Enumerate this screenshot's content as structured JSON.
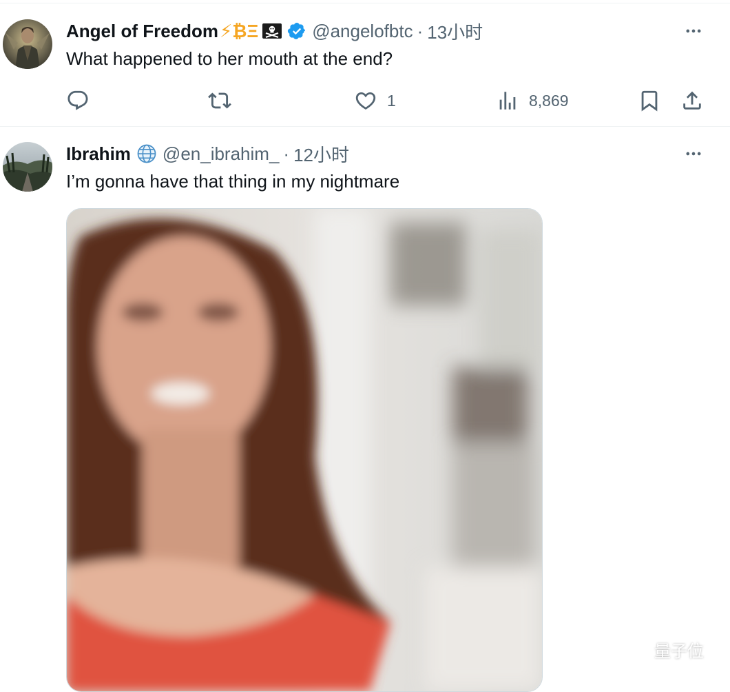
{
  "tweets": [
    {
      "display_name": "Angel of Freedom",
      "name_emoji": "⚡₿Ξ",
      "verified": true,
      "handle": "@angelofbtc",
      "separator": "·",
      "time": "13小时",
      "text": "What happened to her mouth at the end?",
      "actions": {
        "reply_count": "",
        "retweet_count": "",
        "like_count": "1",
        "views_count": "8,869"
      }
    },
    {
      "display_name": "Ibrahim",
      "name_emoji": "",
      "verified": false,
      "handle": "@en_ibrahim_",
      "separator": "·",
      "time": "12小时",
      "text": "I’m gonna have that thing in my nightmare"
    }
  ],
  "watermark": {
    "text": "量子位"
  },
  "icons": {
    "reply": "reply-icon",
    "retweet": "retweet-icon",
    "like": "heart-icon",
    "views": "views-icon",
    "bookmark": "bookmark-icon",
    "share": "share-icon",
    "more": "more-icon",
    "verified": "verified-badge-icon",
    "globe": "globe-icon",
    "pirate_flag": "pirate-flag-icon"
  },
  "colors": {
    "text_primary": "#0f1419",
    "text_secondary": "#536471",
    "verified_blue": "#1d9bf0",
    "divider": "#eff3f4"
  }
}
